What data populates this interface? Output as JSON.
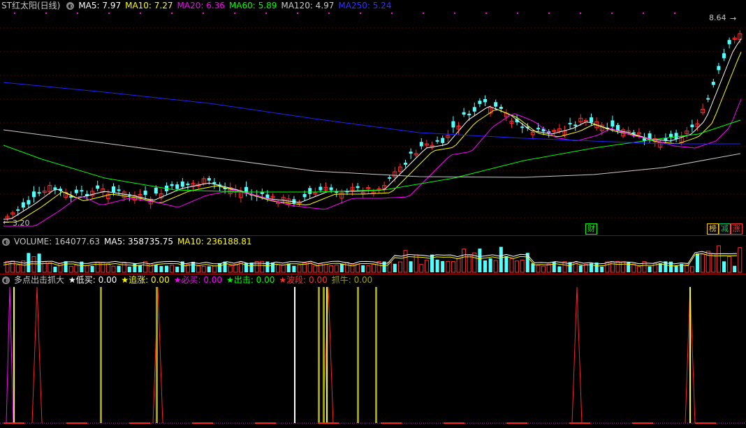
{
  "main": {
    "stock_name": "ST红太阳(日线)",
    "ma": [
      {
        "label": "MA5: 7.97",
        "color": "#ffffff"
      },
      {
        "label": "MA10: 7.27",
        "color": "#ffff00"
      },
      {
        "label": "MA20: 6.36",
        "color": "#ff00ff"
      },
      {
        "label": "MA60: 5.89",
        "color": "#00ff00"
      },
      {
        "label": "MA120: 4.97",
        "color": "#cccccc"
      },
      {
        "label": "MA250: 5.24",
        "color": "#3030ff"
      }
    ],
    "high_label": "8.64",
    "low_label": "3.20",
    "tags": [
      {
        "text": "财",
        "color": "#00ff00"
      },
      {
        "text": "榜",
        "color": "#ffcc00"
      },
      {
        "text": "减",
        "color": "#00cc66"
      },
      {
        "text": "涨",
        "color": "#ff3333"
      }
    ]
  },
  "volume": {
    "title": "VOLUME: 164077.63",
    "ma5": "MA5: 358735.75",
    "ma10": "MA10: 236188.81"
  },
  "indicator": {
    "name": "多点出击抓大",
    "items": [
      {
        "star": "★",
        "label": "低买: 0.00",
        "color": "#ffffff"
      },
      {
        "star": "★",
        "label": "追涨: 0.00",
        "color": "#ffff00"
      },
      {
        "star": "★",
        "label": "必买: 0.00",
        "color": "#ff00ff"
      },
      {
        "star": "★",
        "label": "出击: 0.00",
        "color": "#00ff00"
      },
      {
        "star": "★",
        "label": "波段: 0.00",
        "color": "#ff3333"
      },
      {
        "star": "",
        "label": "抓牛: 0.00",
        "color": "#a0a000"
      }
    ]
  },
  "colors": {
    "up": "#ff3030",
    "down": "#54ffff",
    "grid": "#8b0000"
  }
}
